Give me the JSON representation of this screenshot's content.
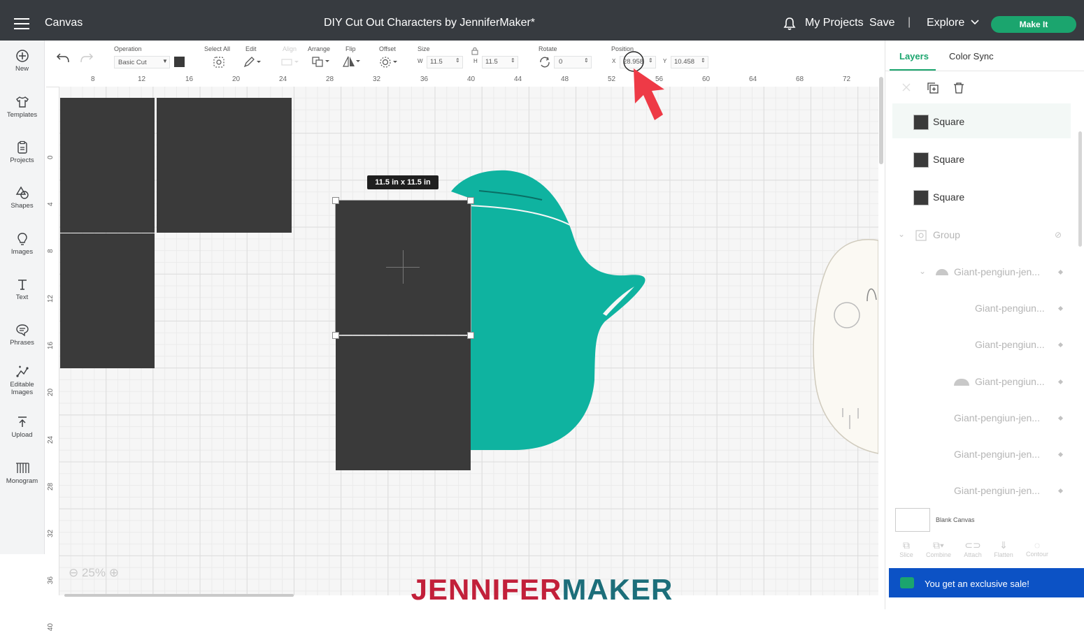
{
  "header": {
    "section_title": "Canvas",
    "project_title": "DIY Cut Out Characters by JenniferMaker*",
    "my_projects": "My Projects",
    "save": "Save",
    "separator": "|",
    "explore": "Explore",
    "make_it": "Make It"
  },
  "sidebar": {
    "items": [
      {
        "label": "New",
        "icon": "plus-circle-icon"
      },
      {
        "label": "Templates",
        "icon": "shirt-icon"
      },
      {
        "label": "Projects",
        "icon": "clipboard-icon"
      },
      {
        "label": "Shapes",
        "icon": "shapes-icon"
      },
      {
        "label": "Images",
        "icon": "lightbulb-icon"
      },
      {
        "label": "Text",
        "icon": "text-t-icon"
      },
      {
        "label": "Phrases",
        "icon": "speech-bubble-icon"
      },
      {
        "label": "Editable",
        "label2": "Images",
        "icon": "editable-images-icon"
      },
      {
        "label": "Upload",
        "icon": "upload-icon"
      },
      {
        "label": "Monogram",
        "icon": "monogram-icon"
      }
    ]
  },
  "toolbar": {
    "operation_label": "Operation",
    "operation_value": "Basic Cut",
    "select_all": "Select All",
    "edit": "Edit",
    "align": "Align",
    "arrange": "Arrange",
    "flip": "Flip",
    "offset": "Offset",
    "size": "Size",
    "w_label": "W",
    "w_value": "11.5",
    "h_label": "H",
    "h_value": "11.5",
    "rotate": "Rotate",
    "rotate_value": "0",
    "position": "Position",
    "x_label": "X",
    "x_value": "28.958",
    "y_label": "Y",
    "y_value": "10.458"
  },
  "ruler": {
    "top": [
      "8",
      "12",
      "16",
      "20",
      "24",
      "28",
      "32",
      "36",
      "40",
      "44",
      "48",
      "52",
      "56",
      "60",
      "64",
      "68",
      "72"
    ],
    "left": [
      "0",
      "4",
      "8",
      "12",
      "16",
      "20",
      "24",
      "28",
      "32",
      "36",
      "40"
    ]
  },
  "canvas": {
    "selection_size": "11.5  in x 11.5  in",
    "zoom": "25%"
  },
  "layers_panel": {
    "tabs": [
      "Layers",
      "Color Sync"
    ],
    "layers": [
      {
        "label": "Square",
        "color": "#3a3a3a"
      },
      {
        "label": "Square",
        "color": "#3a3a3a"
      },
      {
        "label": "Square",
        "color": "#3a3a3a"
      }
    ],
    "group_label": "Group",
    "group_items": [
      "Giant-pengiun-jen...",
      "Giant-pengiun...",
      "Giant-pengiun...",
      "Giant-pengiun...",
      "Giant-pengiun-jen...",
      "Giant-pengiun-jen...",
      "Giant-pengiun-jen..."
    ],
    "blank_canvas": "Blank Canvas",
    "bottom_tools": [
      "Slice",
      "Combine",
      "Attach",
      "Flatten",
      "Contour"
    ],
    "sale_text": "You get an exclusive sale!"
  },
  "watermark": {
    "part1": "JENNIFER",
    "part2": "MAKER"
  },
  "colors": {
    "accent": "#1ba56e",
    "teal_shape": "#0fb3a0",
    "square": "#3a3a3a",
    "sale_bar": "#0c52c5"
  }
}
